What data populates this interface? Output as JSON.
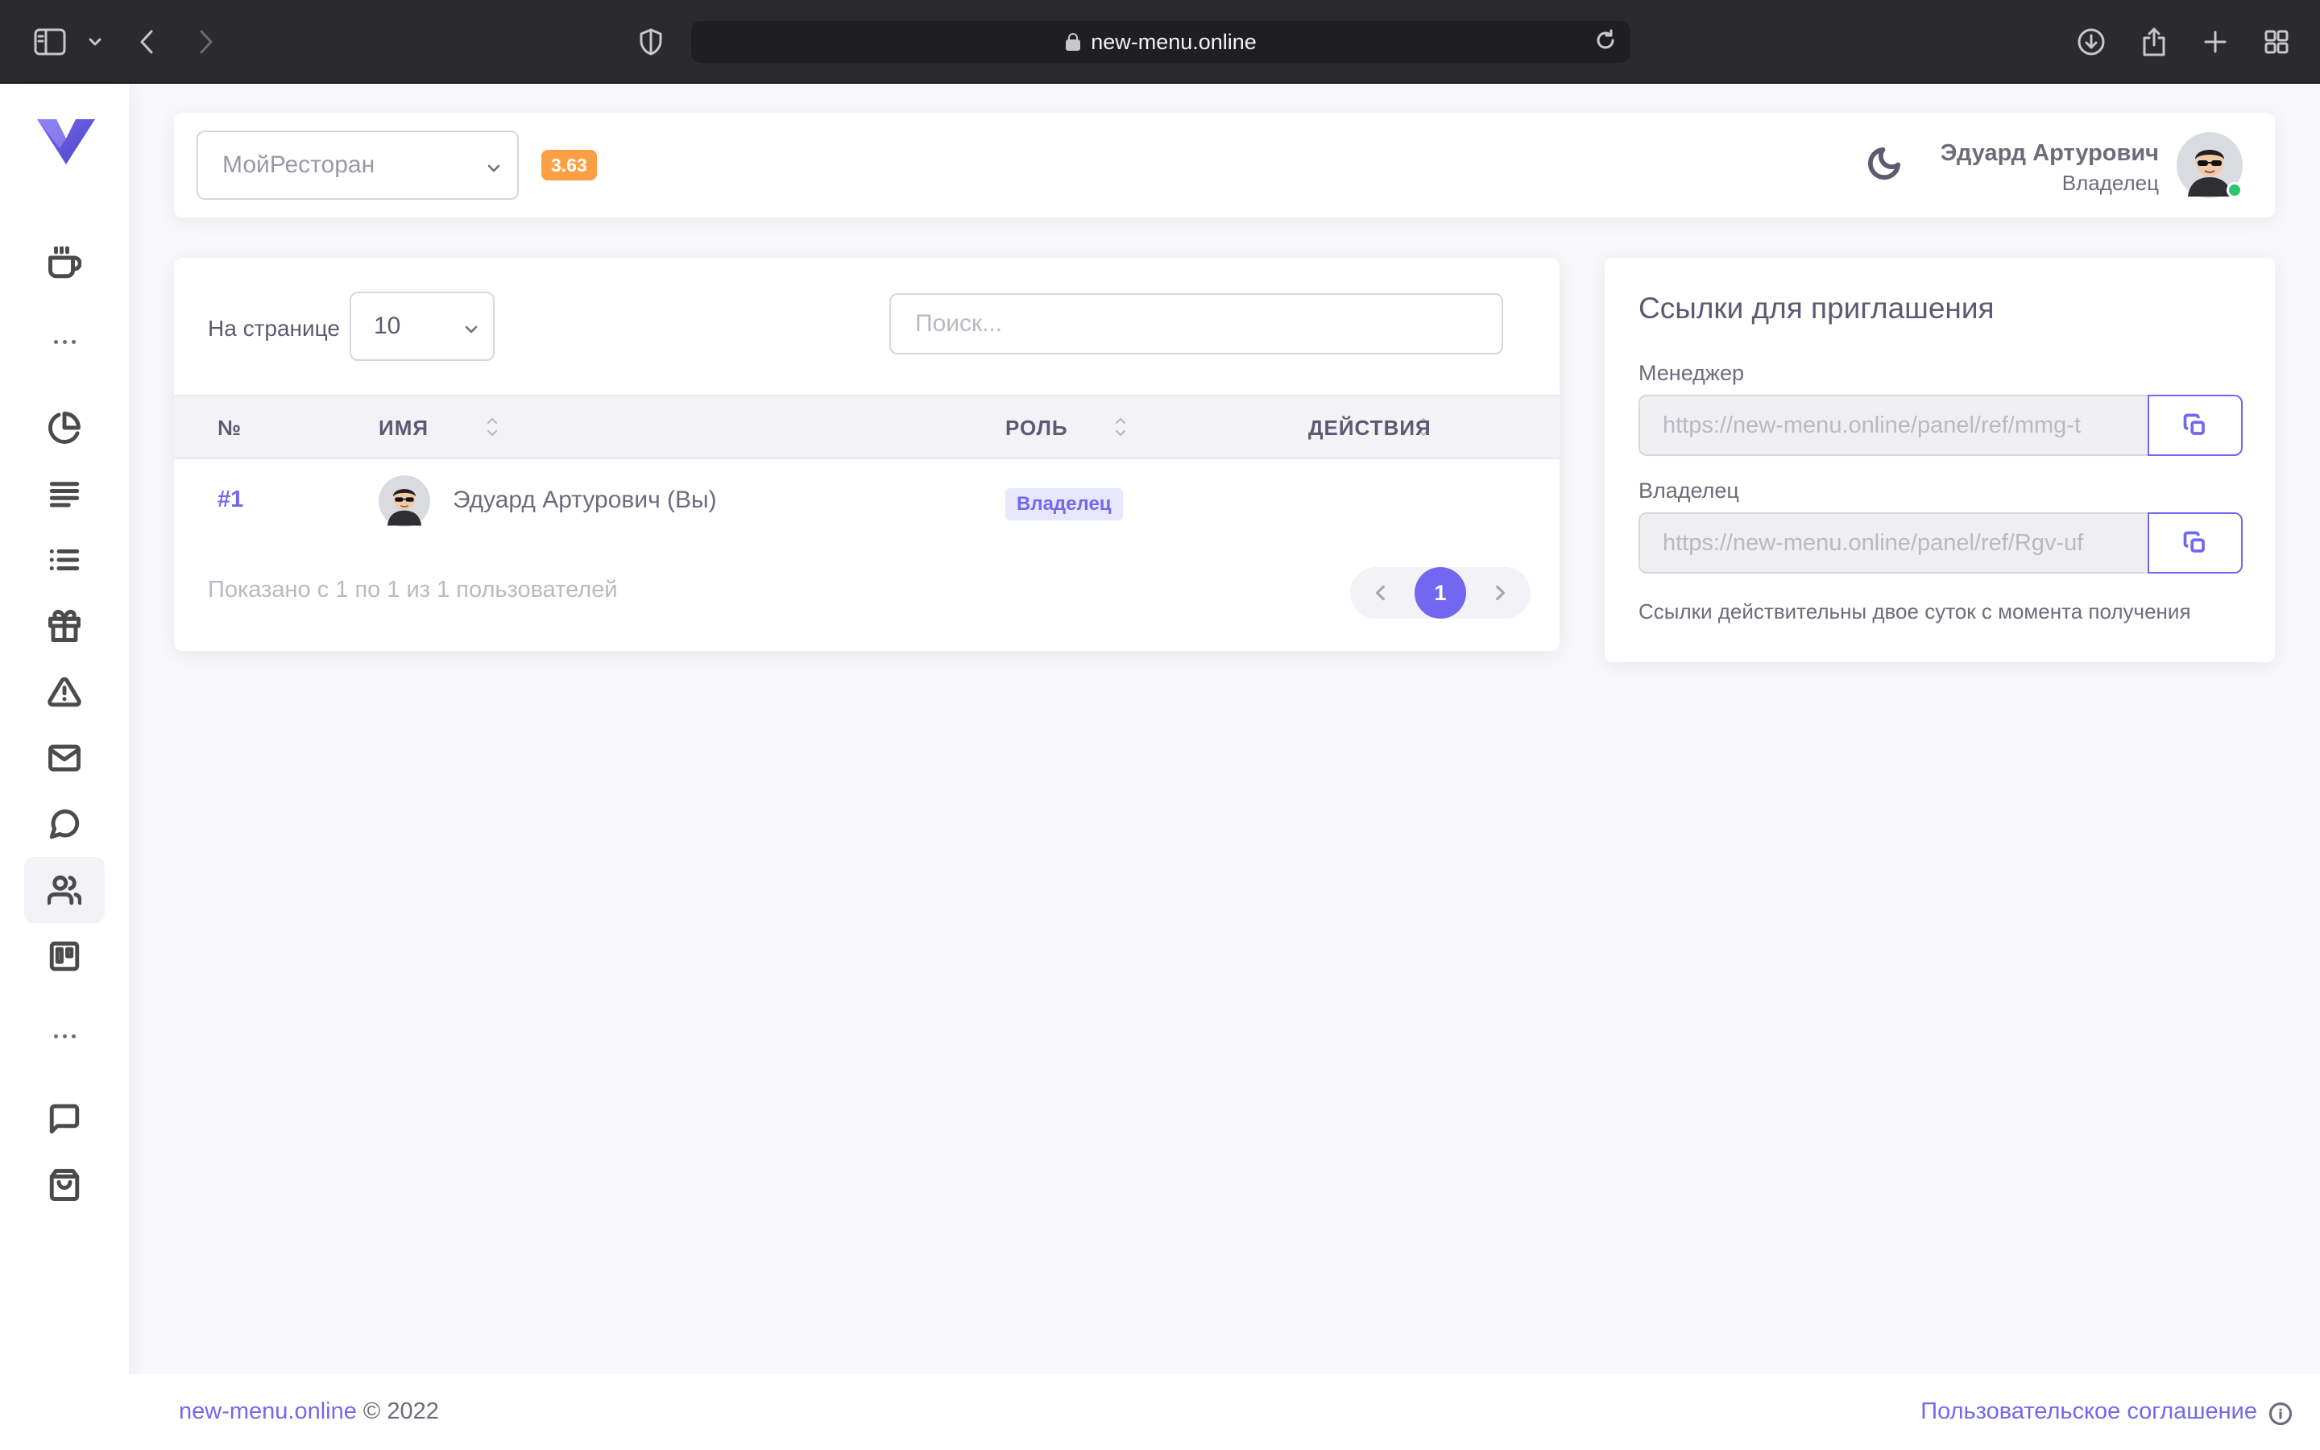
{
  "browser": {
    "url": "new-menu.online"
  },
  "sidebar": {
    "items": [
      {
        "name": "coffee-icon"
      },
      {
        "name": "pie-chart-icon"
      },
      {
        "name": "align-left-icon"
      },
      {
        "name": "list-icon"
      },
      {
        "name": "gift-icon"
      },
      {
        "name": "alert-triangle-icon"
      },
      {
        "name": "mail-icon"
      },
      {
        "name": "message-circle-icon"
      },
      {
        "name": "users-icon",
        "active": true
      },
      {
        "name": "trello-icon"
      },
      {
        "name": "message-square-icon"
      },
      {
        "name": "shopping-bag-icon"
      }
    ]
  },
  "header": {
    "restaurant": "МойРесторан",
    "version": "3.63",
    "user_name": "Эдуард Артурович",
    "user_role": "Владелец"
  },
  "users_table": {
    "per_page_label": "На странице",
    "per_page_value": "10",
    "search_placeholder": "Поиск...",
    "columns": [
      "№",
      "ИМЯ",
      "РОЛЬ",
      "ДЕЙСТВИЯ"
    ],
    "rows": [
      {
        "id": "#1",
        "name": "Эдуард Артурович (Вы)",
        "role": "Владелец"
      }
    ],
    "footer_info": "Показано с 1 по 1 из 1 пользователей",
    "current_page": "1"
  },
  "invite": {
    "title": "Ссылки для приглашения",
    "manager_label": "Менеджер",
    "manager_link": "https://new-menu.online/panel/ref/mmg-t",
    "owner_label": "Владелец",
    "owner_link": "https://new-menu.online/panel/ref/Rgv-uf",
    "note": "Ссылки действительны двое суток с момента получения"
  },
  "footer": {
    "brand": "new-menu.online",
    "copyright": " © 2022",
    "agreement": "Пользовательское соглашение"
  },
  "colors": {
    "primary": "#7367f0",
    "warning": "#ff9f43",
    "success": "#28c76f"
  }
}
